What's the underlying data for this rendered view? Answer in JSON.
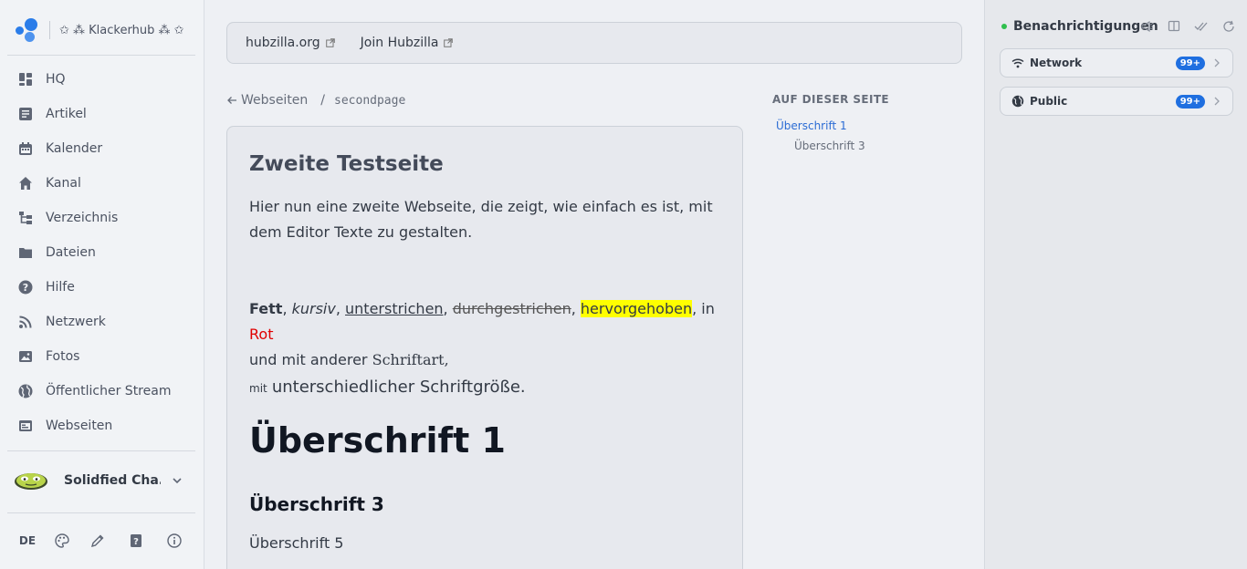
{
  "brand": {
    "hub_name": "✩ ⁂ Klackerhub ⁂ ✩"
  },
  "nav": {
    "items": [
      {
        "label": "HQ",
        "icon": "hq-icon"
      },
      {
        "label": "Artikel",
        "icon": "articles-icon"
      },
      {
        "label": "Kalender",
        "icon": "calendar-icon"
      },
      {
        "label": "Kanal",
        "icon": "home-icon"
      },
      {
        "label": "Verzeichnis",
        "icon": "directory-icon"
      },
      {
        "label": "Dateien",
        "icon": "folder-icon"
      },
      {
        "label": "Hilfe",
        "icon": "help-icon"
      },
      {
        "label": "Netzwerk",
        "icon": "rss-icon"
      },
      {
        "label": "Fotos",
        "icon": "image-icon"
      },
      {
        "label": "Öffentlicher Stream",
        "icon": "globe-icon"
      },
      {
        "label": "Webseiten",
        "icon": "webpages-icon"
      }
    ]
  },
  "channel": {
    "name": "Solidfied Cha..."
  },
  "footer": {
    "lang": "DE"
  },
  "topbar": {
    "links": [
      {
        "label": "hubzilla.org"
      },
      {
        "label": "Join Hubzilla"
      }
    ]
  },
  "breadcrumb": {
    "parent": "Webseiten",
    "current": "secondpage"
  },
  "page": {
    "title": "Zweite Testseite",
    "intro": "Hier nun eine zweite Webseite, die zeigt, wie einfach es ist, mit dem Editor Texte zu gestalten.",
    "bold": "Fett",
    "italic": "kursiv",
    "underline": "unterstrichen",
    "strike": "durchgestrichen",
    "highlight": "hervorgehoben",
    "in_text": ", in",
    "red": "Rot",
    "font_line_a": "und mit anderer",
    "font_name": "Schriftart,",
    "size_small": "mit",
    "size_large": "unterschiedlicher Schriftgröße.",
    "h1": "Überschrift 1",
    "h3": "Überschrift 3",
    "h5": "Überschrift 5"
  },
  "toc": {
    "title": "AUF DIESER SEITE",
    "items": [
      {
        "label": "Überschrift 1"
      },
      {
        "label": "Überschrift 3"
      }
    ]
  },
  "notifications": {
    "title": "Benachrichtigungen",
    "status_color": "#2fbf4d",
    "items": [
      {
        "label": "Network",
        "badge": "99+",
        "icon": "wifi-icon"
      },
      {
        "label": "Public",
        "badge": "99+",
        "icon": "globe-icon"
      }
    ]
  },
  "colors": {
    "accent": "#2b7de9",
    "link": "#2b6cd4",
    "badge": "#1f6fe0",
    "highlight": "#ffff00",
    "red": "#e00000"
  }
}
